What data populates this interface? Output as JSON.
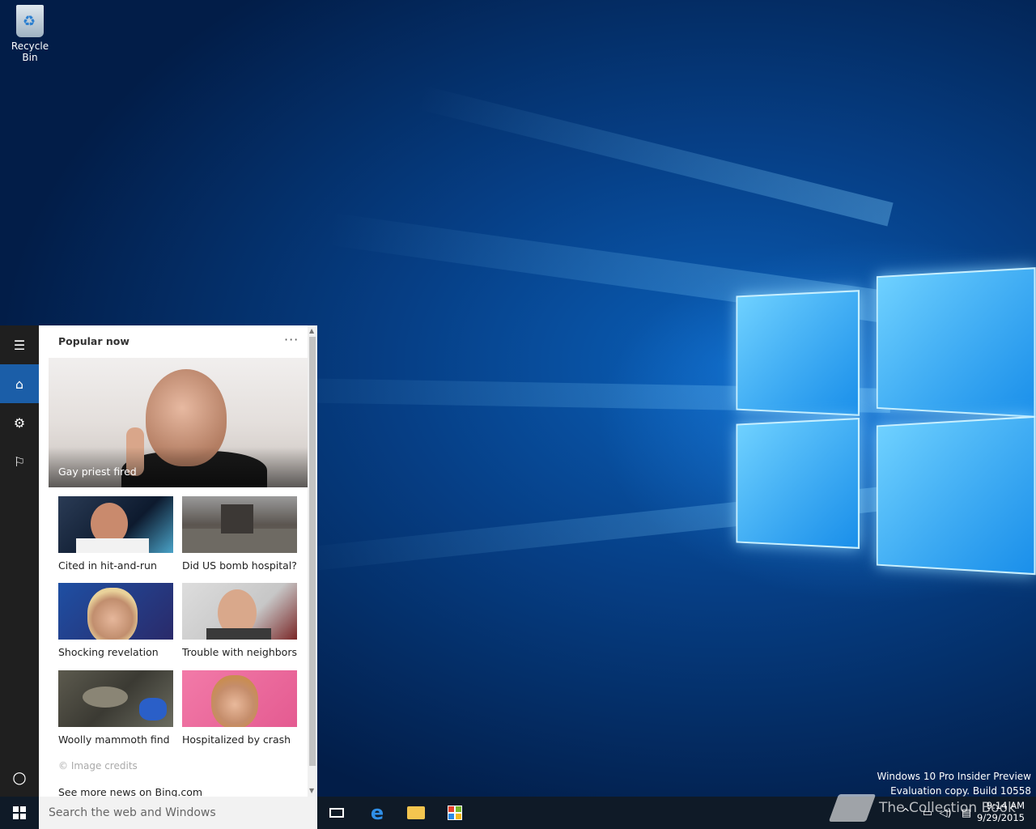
{
  "desktop": {
    "recycle_bin_label": "Recycle Bin",
    "watermark_line1": "Windows 10 Pro Insider Preview",
    "watermark_line2": "Evaluation copy. Build 10558"
  },
  "rail": {
    "items": [
      {
        "name": "hamburger-icon",
        "glyph": "☰"
      },
      {
        "name": "home-icon",
        "glyph": "⌂"
      },
      {
        "name": "settings-icon",
        "glyph": "⚙"
      },
      {
        "name": "feedback-icon",
        "glyph": "⚐"
      }
    ],
    "cortana_glyph": "○"
  },
  "panel": {
    "header": "Popular now",
    "more_glyph": "···",
    "hero": {
      "caption": "Gay priest fired"
    },
    "tiles": [
      {
        "caption": "Cited in hit-and-run"
      },
      {
        "caption": "Did US bomb hospital?"
      },
      {
        "caption": "Shocking revelation"
      },
      {
        "caption": "Trouble with neighbors"
      },
      {
        "caption": "Woolly mammoth find"
      },
      {
        "caption": "Hospitalized by crash"
      }
    ],
    "credits": "© Image credits",
    "see_more": "See more news on Bing.com"
  },
  "taskbar": {
    "search_placeholder": "Search the web and Windows",
    "time": "9:14 AM",
    "date": "9/29/2015",
    "brand_text": "The Collection Book"
  }
}
